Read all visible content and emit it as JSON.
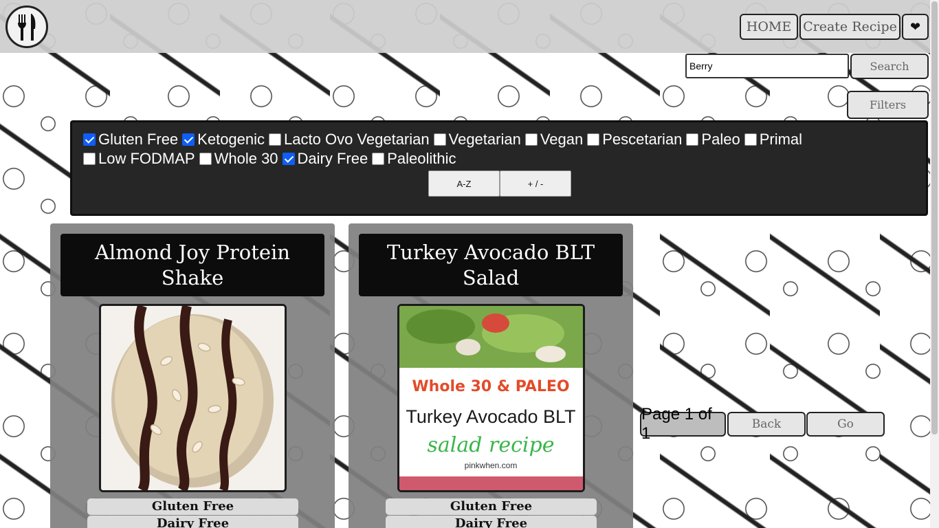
{
  "header": {
    "logo_icon": "fork-knife-icon",
    "nav": {
      "home": "HOME",
      "create_recipe": "Create Recipe",
      "favorites": "❤"
    }
  },
  "search": {
    "value": "Berry",
    "button": "Search",
    "filters_button": "Filters"
  },
  "filters": {
    "items": [
      {
        "label": "Gluten Free",
        "checked": true
      },
      {
        "label": "Ketogenic",
        "checked": true
      },
      {
        "label": "Lacto Ovo Vegetarian",
        "checked": false
      },
      {
        "label": "Vegetarian",
        "checked": false
      },
      {
        "label": "Vegan",
        "checked": false
      },
      {
        "label": "Pescetarian",
        "checked": false
      },
      {
        "label": "Paleo",
        "checked": false
      },
      {
        "label": "Primal",
        "checked": false
      },
      {
        "label": "Low FODMAP",
        "checked": false
      },
      {
        "label": "Whole 30",
        "checked": false
      },
      {
        "label": "Dairy Free",
        "checked": true
      },
      {
        "label": "Paleolithic",
        "checked": false
      }
    ],
    "sort_buttons": {
      "alpha": "A-Z",
      "toggle": "+ / -"
    }
  },
  "recipes": [
    {
      "title": "Almond Joy Protein Shake",
      "tags": [
        "Gluten Free",
        "Dairy Free"
      ]
    },
    {
      "title": "Turkey Avocado BLT Salad",
      "tags": [
        "Gluten Free",
        "Dairy Free"
      ],
      "image_text": {
        "line1": "Whole 30 & PALEO",
        "line2": "Turkey Avocado BLT",
        "line3": "salad recipe",
        "line4": "pinkwhen.com"
      }
    }
  ],
  "pagination": {
    "label": "Page 1 of 1",
    "back": "Back",
    "go": "Go"
  },
  "colors": {
    "checkbox_checked": "#0f5ef7",
    "panel_bg": "#262626",
    "card_bg": "#808080"
  }
}
